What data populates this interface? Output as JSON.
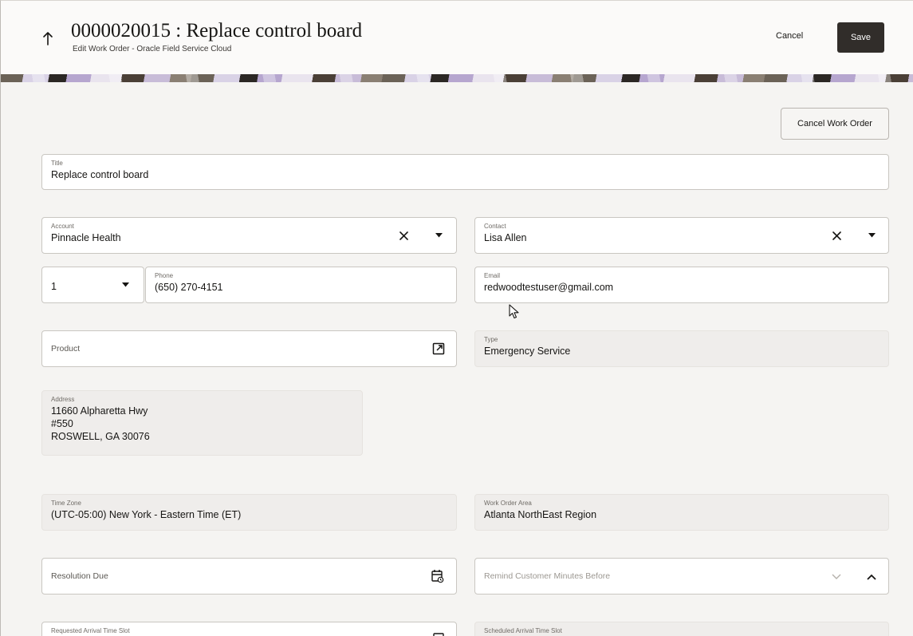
{
  "header": {
    "title": "0000020015 : Replace control board",
    "subtitle": "Edit Work Order - Oracle Field Service Cloud",
    "cancel_label": "Cancel",
    "save_label": "Save"
  },
  "actions": {
    "cancel_work_order_label": "Cancel Work Order"
  },
  "form": {
    "title": {
      "label": "Title",
      "value": "Replace control board"
    },
    "account": {
      "label": "Account",
      "value": "Pinnacle Health"
    },
    "contact": {
      "label": "Contact",
      "value": "Lisa Allen"
    },
    "phone_type": {
      "value": "1"
    },
    "phone": {
      "label": "Phone",
      "value": "(650) 270-4151"
    },
    "email": {
      "label": "Email",
      "value": "redwoodtestuser@gmail.com"
    },
    "product": {
      "placeholder": "Product"
    },
    "type": {
      "label": "Type",
      "value": "Emergency Service"
    },
    "address": {
      "label": "Address",
      "line1": "11660 Alpharetta Hwy",
      "line2": "#550",
      "line3": "ROSWELL, GA 30076"
    },
    "time_zone": {
      "label": "Time Zone",
      "value": "(UTC-05:00) New York - Eastern Time (ET)"
    },
    "work_order_area": {
      "label": "Work Order Area",
      "value": "Atlanta NorthEast Region"
    },
    "resolution_due": {
      "placeholder": "Resolution Due"
    },
    "remind_minutes": {
      "placeholder": "Remind Customer Minutes Before"
    },
    "requested_slot": {
      "label": "Requested Arrival Time Slot"
    },
    "scheduled_slot": {
      "label": "Scheduled Arrival Time Slot"
    }
  },
  "icons": {
    "back": "arrow-up-icon",
    "clear": "close-icon",
    "dropdown": "caret-down-icon",
    "external": "open-external-icon",
    "calendar": "calendar-icon",
    "chevron_down": "chevron-down-icon",
    "chevron_up": "chevron-up-icon"
  }
}
